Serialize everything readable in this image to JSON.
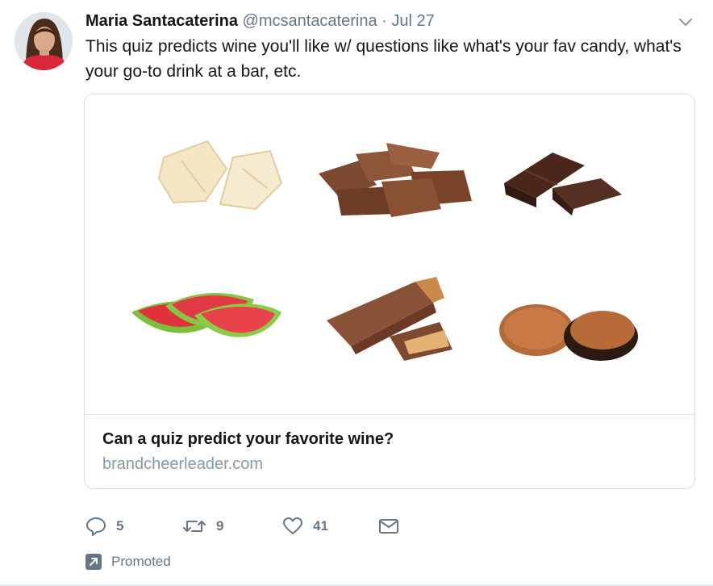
{
  "tweet": {
    "author_name": "Maria Santacaterina",
    "author_handle": "@mcsantacaterina",
    "separator": "·",
    "date": "Jul 27",
    "text": "This quiz predicts wine you'll like w/ questions like what's your fav candy, what's your go-to drink at a bar, etc.",
    "card": {
      "title": "Can a quiz predict your favorite wine?",
      "domain": "brandcheerleader.com",
      "image_items": [
        "white-chocolate",
        "milk-chocolate-pieces",
        "dark-chocolate-bar",
        "watermelon-candy-slices",
        "caramel-candy-bar",
        "peanut-butter-cups"
      ]
    },
    "actions": {
      "reply_count": "5",
      "retweet_count": "9",
      "like_count": "41"
    },
    "promoted_label": "Promoted"
  },
  "icons": {
    "caret": "chevron-down-icon",
    "reply": "reply-icon",
    "retweet": "retweet-icon",
    "like": "heart-icon",
    "dm": "envelope-icon",
    "promoted": "promoted-arrow-icon"
  },
  "colors": {
    "text_primary": "#14171a",
    "text_secondary": "#657786",
    "domain": "#8899a6",
    "border": "#d8dfe4"
  }
}
